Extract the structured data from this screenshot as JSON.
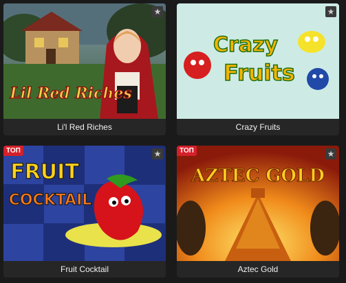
{
  "games": [
    {
      "title": "Li'l Red Riches",
      "badge": "",
      "logo_text": "Lil Red Riches"
    },
    {
      "title": "Crazy Fruits",
      "badge": "",
      "logo_line1": "Crazy",
      "logo_line2": "Fruits"
    },
    {
      "title": "Fruit Cocktail",
      "badge": "ТОП",
      "logo_line1": "FRUIT",
      "logo_line2": "COCKTAIL"
    },
    {
      "title": "Aztec Gold",
      "badge": "ТОП",
      "logo_text": "AZTEC GOLD"
    }
  ],
  "favorite_icon": "star-icon",
  "colors": {
    "badge": "#d5202a",
    "caption_bg": "#262626",
    "page_bg": "#1a1a1a"
  }
}
